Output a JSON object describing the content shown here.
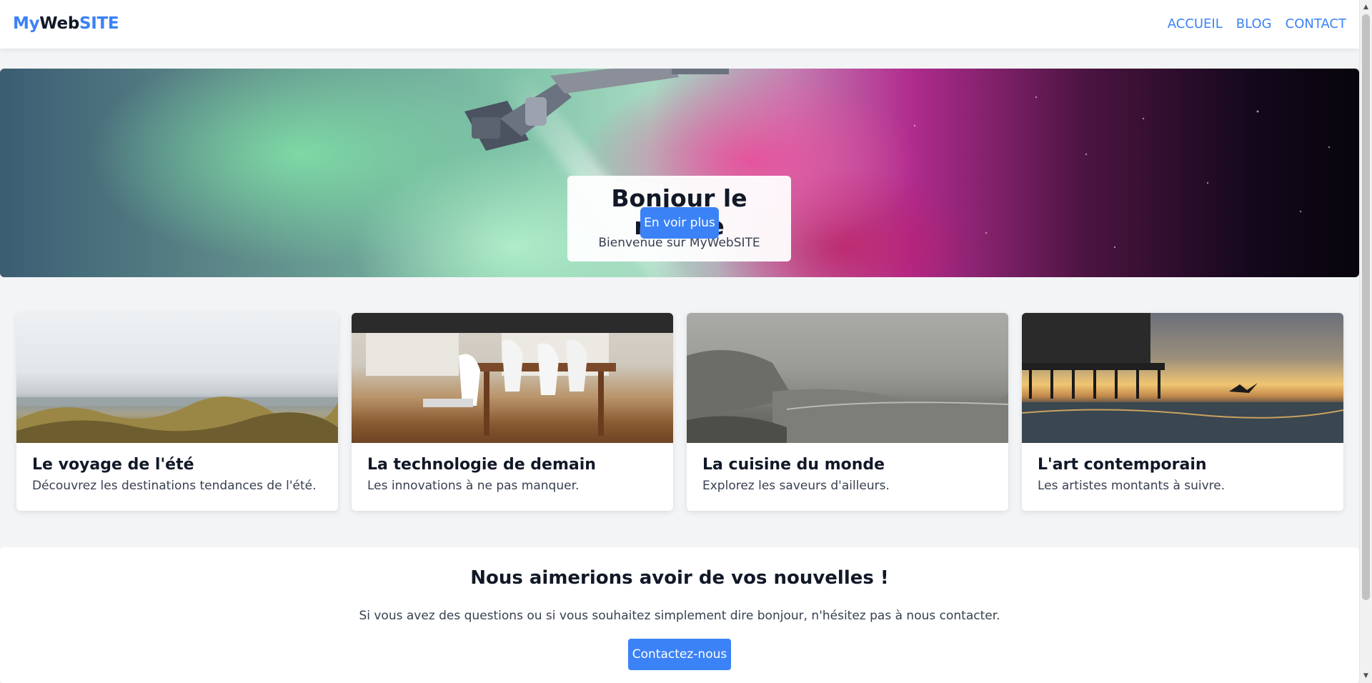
{
  "header": {
    "logo_my": "My",
    "logo_web": "Web",
    "logo_site": "SITE",
    "nav": [
      "ACCUEIL",
      "BLOG",
      "CONTACT"
    ]
  },
  "hero": {
    "title": "Bonjour le monde",
    "subtitle": "Bienvenue sur MyWebSITE",
    "button": "En voir plus"
  },
  "cards": [
    {
      "title": "Le voyage de l'été",
      "description": "Découvrez les destinations tendances de l'été."
    },
    {
      "title": "La technologie de demain",
      "description": "Les innovations à ne pas manquer."
    },
    {
      "title": "La cuisine du monde",
      "description": "Explorez les saveurs d'ailleurs."
    },
    {
      "title": "L'art contemporain",
      "description": "Les artistes montants à suivre."
    }
  ],
  "contact": {
    "title": "Nous aimerions avoir de vos nouvelles !",
    "text": "Si vous avez des questions ou si vous souhaitez simplement dire bonjour, n'hésitez pas à nous contacter.",
    "button": "Contactez-nous"
  },
  "colors": {
    "accent": "#3b82f6",
    "background": "#f3f4f6",
    "text": "#111827"
  }
}
